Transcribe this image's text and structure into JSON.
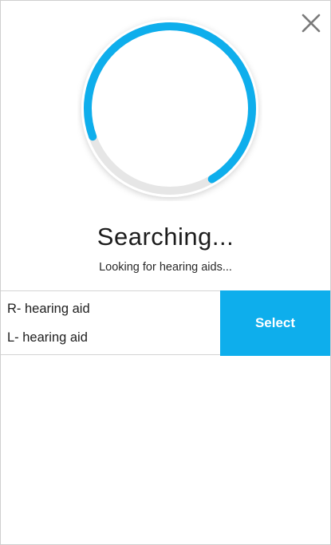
{
  "dialog": {
    "close_icon": "close-icon",
    "title": "Searching...",
    "subtitle": "Looking for hearing aids..."
  },
  "progress": {
    "fraction_complete": 0.72,
    "accent_color": "#0eaeec",
    "track_color": "#e6e6e6"
  },
  "devices": {
    "right": "R- hearing aid",
    "left": "L- hearing aid",
    "select_label": "Select"
  }
}
